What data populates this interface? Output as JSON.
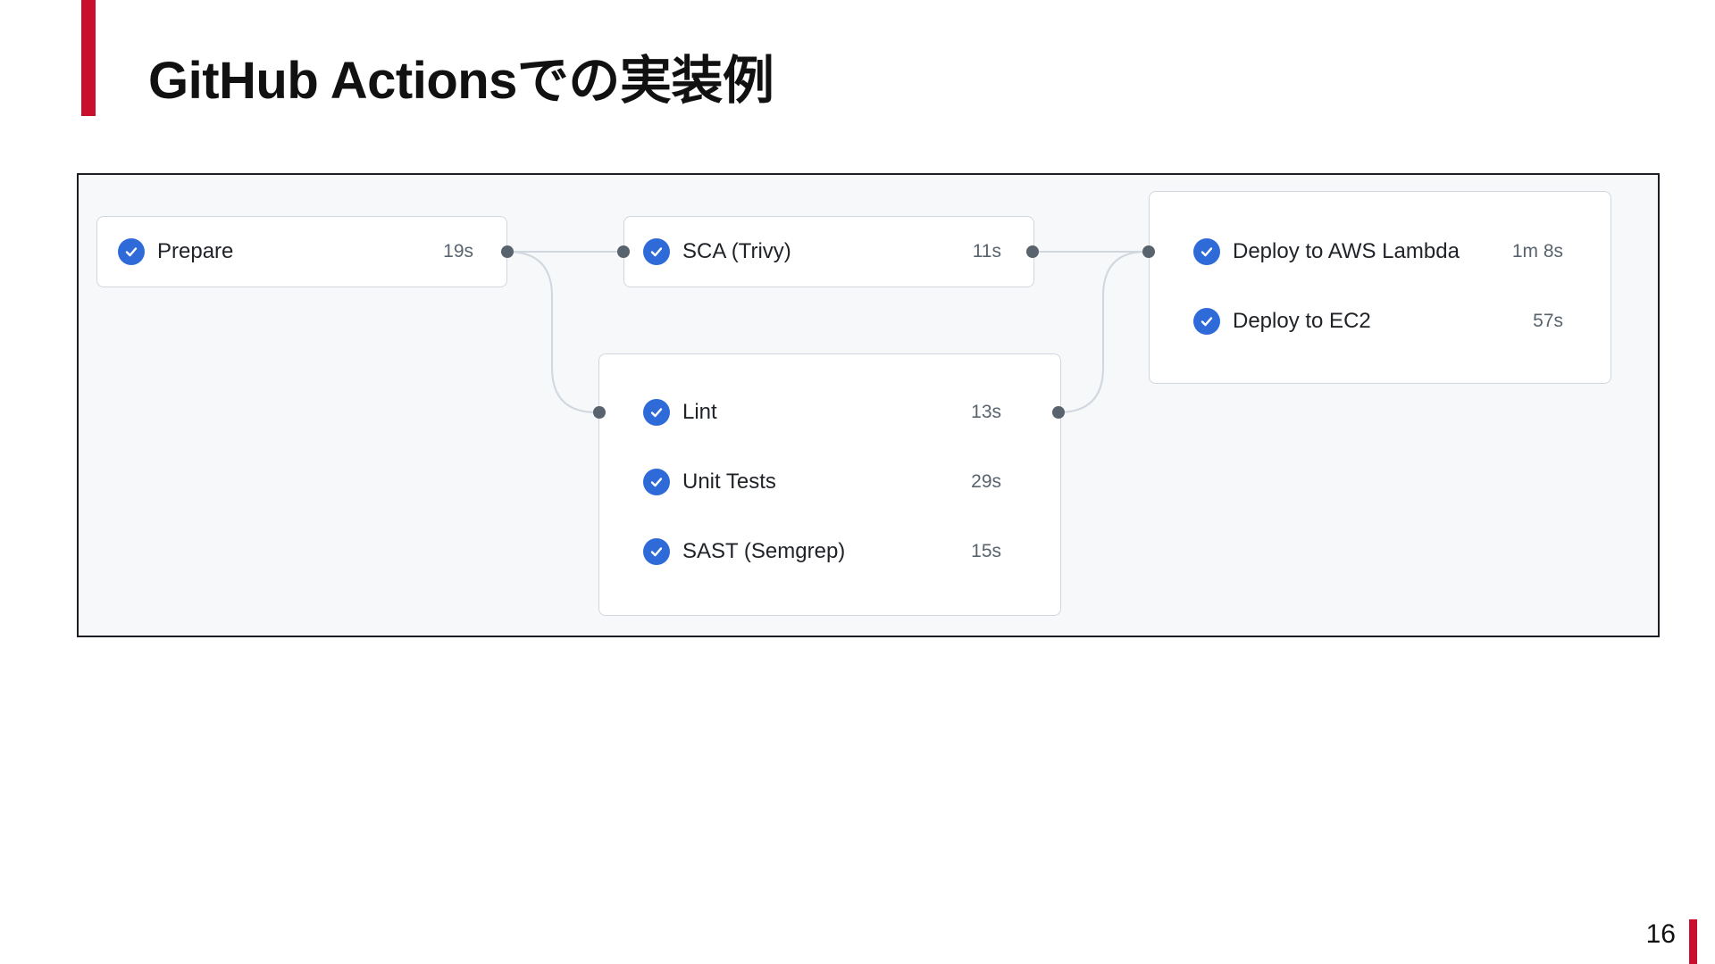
{
  "slide": {
    "title": "GitHub Actionsでの実装例",
    "page_number": "16",
    "accent_color": "#c8102e"
  },
  "workflow": {
    "status_icon": "check-circle-icon",
    "status_color": "#2f6bd8",
    "stages": [
      {
        "jobs": [
          {
            "name": "Prepare",
            "duration": "19s"
          }
        ]
      },
      {
        "jobs": [
          {
            "name": "SCA (Trivy)",
            "duration": "11s"
          }
        ]
      },
      {
        "jobs": [
          {
            "name": "Lint",
            "duration": "13s"
          },
          {
            "name": "Unit Tests",
            "duration": "29s"
          },
          {
            "name": "SAST (Semgrep)",
            "duration": "15s"
          }
        ]
      },
      {
        "jobs": [
          {
            "name": "Deploy to AWS Lambda",
            "duration": "1m 8s"
          },
          {
            "name": "Deploy to EC2",
            "duration": "57s"
          }
        ]
      }
    ]
  }
}
